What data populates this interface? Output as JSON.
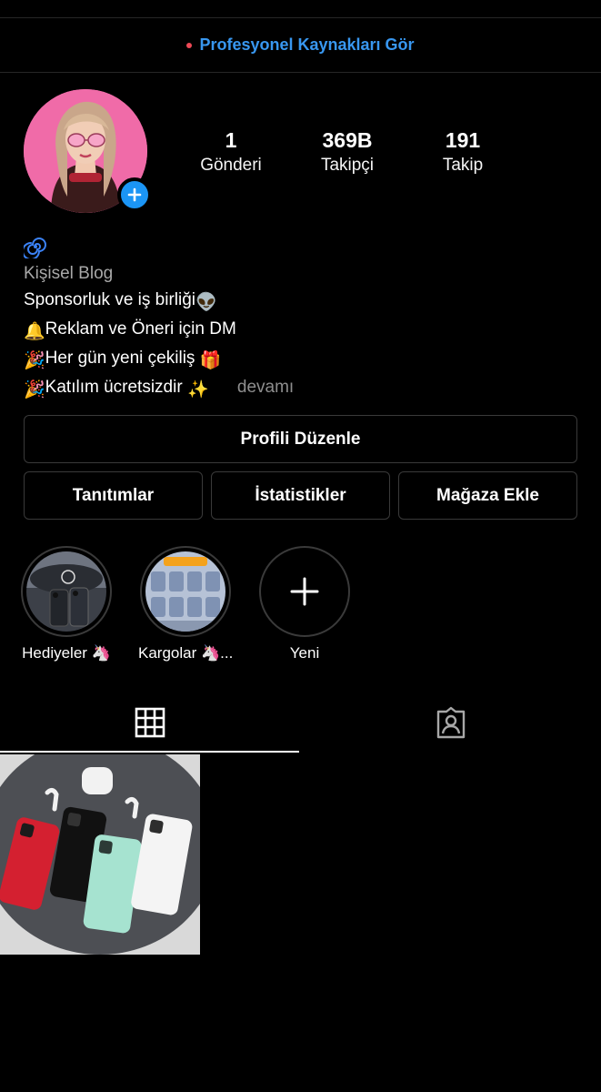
{
  "banner": {
    "text": "Profesyonel Kaynakları Gör",
    "dot_color": "#ed4956",
    "text_color": "#3897f0"
  },
  "profile": {
    "avatar_icon": "avatar",
    "add_icon": "plus-icon",
    "stats": [
      {
        "value": "1",
        "label": "Gönderi"
      },
      {
        "value": "369B",
        "label": "Takipçi"
      },
      {
        "value": "191",
        "label": "Takip"
      }
    ]
  },
  "bio": {
    "icon": "spiral-icon",
    "category": "Kişisel Blog",
    "line1": "Sponsorluk ve iş birliği",
    "line1_emoji": "👽",
    "line2_emoji": "🔔",
    "line2": "Reklam ve Öneri için DM",
    "line3_emoji": "🎉",
    "line3": "Her gün yeni çekiliş",
    "line3_end_emoji": "🎁",
    "line4_emoji": "🎉",
    "line4": "Katılım ücretsizdir",
    "line4_end_emoji": "✨",
    "more": "devamı"
  },
  "buttons": {
    "edit_profile": "Profili Düzenle",
    "promotions": "Tanıtımlar",
    "insights": "İstatistikler",
    "add_shop": "Mağaza Ekle"
  },
  "highlights": [
    {
      "label": "Hediyeler 🦄"
    },
    {
      "label": "Kargolar 🦄..."
    },
    {
      "label": "Yeni"
    }
  ],
  "tabs": [
    {
      "icon": "grid-icon",
      "active": true
    },
    {
      "icon": "tagged-icon",
      "active": false
    }
  ],
  "colors": {
    "accent": "#3897f0",
    "badge": "#1b95f5",
    "avatar_bg": "#f06ba8"
  }
}
